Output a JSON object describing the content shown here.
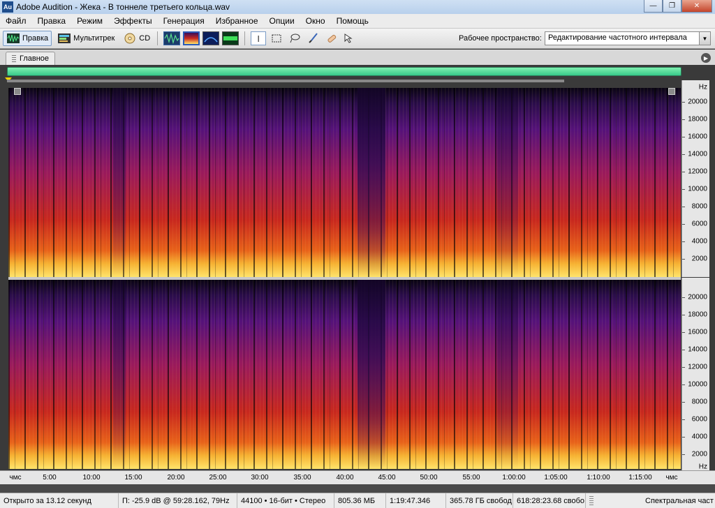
{
  "window": {
    "app_icon": "Au",
    "title": "Adobe Audition - Жека - В тоннеле третьего кольца.wav",
    "minimize": "—",
    "maximize": "❐",
    "close": "✕"
  },
  "menu": [
    "Файл",
    "Правка",
    "Режим",
    "Эффекты",
    "Генерация",
    "Избранное",
    "Опции",
    "Окно",
    "Помощь"
  ],
  "toolbar": {
    "edit_label": "Правка",
    "multitrack_label": "Мультитрек",
    "cd_label": "CD",
    "workspace_label": "Рабочее пространство:",
    "workspace_value": "Редактирование частотного интервала"
  },
  "panel": {
    "tab_label": "Главное"
  },
  "freq_axis": {
    "unit": "Hz",
    "labels": [
      "20000",
      "18000",
      "16000",
      "14000",
      "12000",
      "10000",
      "8000",
      "6000",
      "4000",
      "2000"
    ]
  },
  "time_axis": {
    "labels": [
      "чмс",
      "5:00",
      "10:00",
      "15:00",
      "20:00",
      "25:00",
      "30:00",
      "35:00",
      "40:00",
      "45:00",
      "50:00",
      "55:00",
      "1:00:00",
      "1:05:00",
      "1:10:00",
      "1:15:00",
      "чмс"
    ]
  },
  "status": {
    "opened": "Открыто за 13.12 секунд",
    "cursor": "П: -25.9 dB @ 59:28.162, 79Hz",
    "format": "44100 • 16-бит • Стерео",
    "size": "805.36 МБ",
    "duration": "1:19:47.346",
    "free_space": "365.78 ГБ свобод",
    "free_time": "618:28:23.68 свобо",
    "view_mode": "Спектральная част"
  },
  "colors": {
    "overview_green": "#3ed08f",
    "spectrum_hot": "#ffe46a",
    "spectrum_mid": "#c8281e",
    "spectrum_cold": "#55127a"
  }
}
